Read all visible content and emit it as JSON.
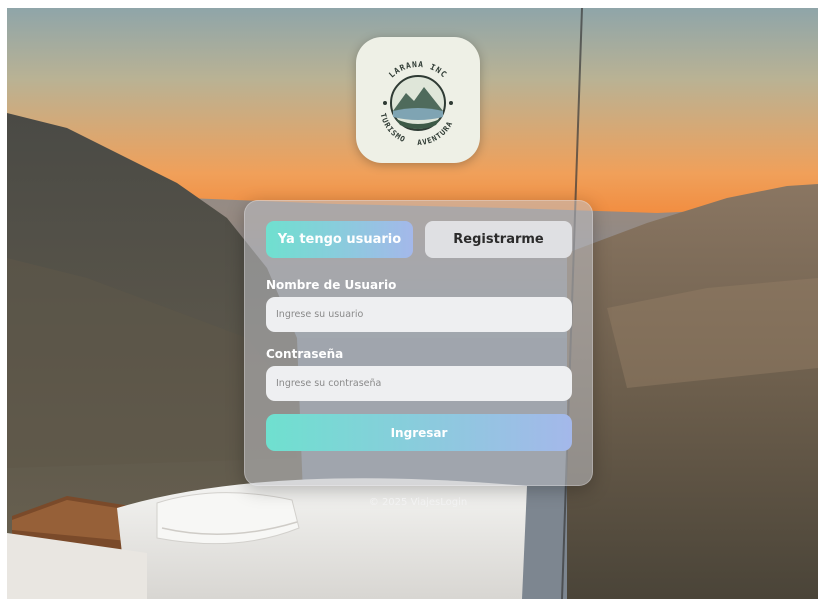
{
  "logo": {
    "brand": "LARANA INC",
    "left_text": "TURISMO",
    "bottom_text": "AVENTURA"
  },
  "tabs": [
    {
      "label": "Ya tengo usuario",
      "active": true
    },
    {
      "label": "Registrarme",
      "active": false
    }
  ],
  "form": {
    "username_label": "Nombre de Usuario",
    "username_placeholder": "Ingrese su usuario",
    "username_value": "",
    "password_label": "Contraseña",
    "password_placeholder": "Ingrese su contraseña",
    "password_value": "",
    "submit_label": "Ingresar"
  },
  "footer": "© 2025 ViajesLogin",
  "colors": {
    "gradient_start": "#6fe0cf",
    "gradient_end": "#a4b8ea"
  },
  "icons": {
    "logo": "mountain-lake-emblem"
  }
}
